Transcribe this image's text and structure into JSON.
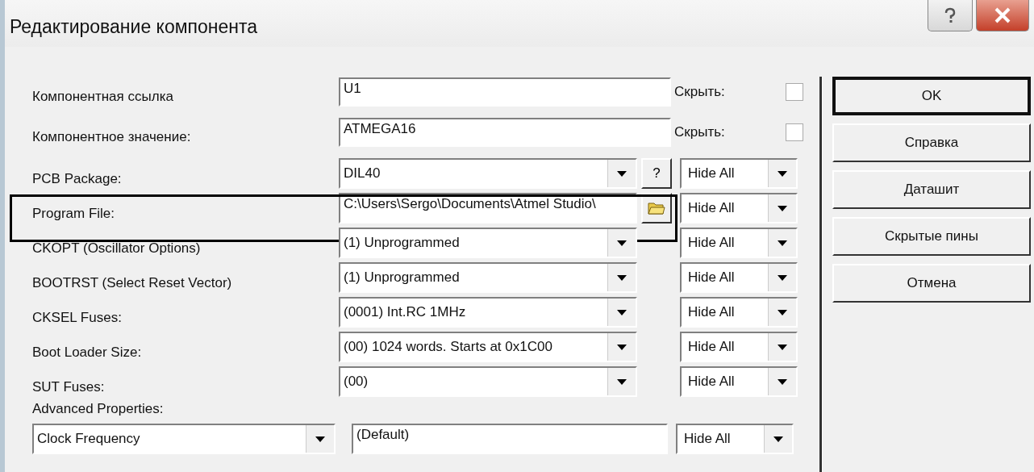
{
  "window": {
    "title": "Редактирование компонента"
  },
  "rows": [
    {
      "kind": "text_hide",
      "label": "Компонентная ссылка",
      "value": "U1",
      "hide_label": "Скрыть:",
      "hide_checked": false,
      "highlighted": false
    },
    {
      "kind": "text_hide",
      "label": "Компонентное значение:",
      "value": "ATMEGA16",
      "hide_label": "Скрыть:",
      "hide_checked": false,
      "highlighted": false
    },
    {
      "kind": "combo_help",
      "label": "PCB Package:",
      "value": "DIL40",
      "button": "?",
      "visibility": "Hide All",
      "highlighted": false
    },
    {
      "kind": "file",
      "label": "Program File:",
      "value": "C:\\Users\\Sergo\\Documents\\Atmel Studio\\",
      "visibility": "Hide All",
      "highlighted": true
    },
    {
      "kind": "combo",
      "label": "CKOPT (Oscillator Options)",
      "value": "(1) Unprogrammed",
      "visibility": "Hide All",
      "highlighted": false
    },
    {
      "kind": "combo",
      "label": "BOOTRST (Select Reset Vector)",
      "value": "(1) Unprogrammed",
      "visibility": "Hide All",
      "highlighted": false
    },
    {
      "kind": "combo",
      "label": "CKSEL Fuses:",
      "value": "(0001) Int.RC 1MHz",
      "visibility": "Hide All",
      "highlighted": false
    },
    {
      "kind": "combo",
      "label": "Boot Loader Size:",
      "value": "(00) 1024 words. Starts at 0x1C00",
      "visibility": "Hide All",
      "highlighted": false
    },
    {
      "kind": "combo",
      "label": "SUT Fuses:",
      "value": "(00)",
      "visibility": "Hide All",
      "highlighted": false
    }
  ],
  "advanced": {
    "label": "Advanced Properties:",
    "property": "Clock Frequency",
    "value": "(Default)",
    "visibility": "Hide All"
  },
  "buttons": [
    {
      "label": "OK",
      "default": true
    },
    {
      "label": "Справка",
      "default": false
    },
    {
      "label": "Даташит",
      "default": false
    },
    {
      "label": "Скрытые пины",
      "default": false
    },
    {
      "label": "Отмена",
      "default": false
    }
  ]
}
